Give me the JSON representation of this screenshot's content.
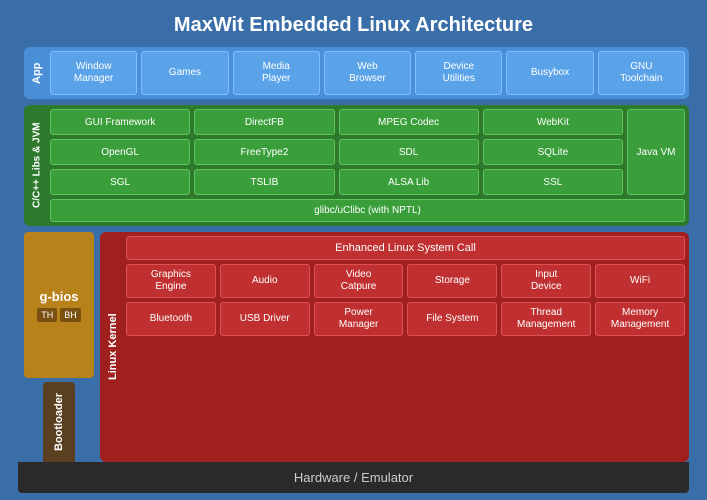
{
  "title": "MaxWit Embedded Linux Architecture",
  "layers": {
    "app": {
      "label": "App",
      "items": [
        {
          "label": "Window\nManager"
        },
        {
          "label": "Games"
        },
        {
          "label": "Media\nPlayer"
        },
        {
          "label": "Web\nBrowser"
        },
        {
          "label": "Device\nUtilities"
        },
        {
          "label": "Busybox"
        },
        {
          "label": "GNU\nToolchain"
        }
      ]
    },
    "libs": {
      "label": "C/C++ Libs & JVM",
      "rows": [
        [
          {
            "label": "GUI Framework"
          },
          {
            "label": "DirectFB"
          },
          {
            "label": "MPEG Codec"
          },
          {
            "label": "WebKit"
          }
        ],
        [
          {
            "label": "OpenGL"
          },
          {
            "label": "FreeType2"
          },
          {
            "label": "SDL"
          },
          {
            "label": "SQLite"
          }
        ],
        [
          {
            "label": "SGL"
          },
          {
            "label": "TSLIB"
          },
          {
            "label": "ALSA Lib"
          },
          {
            "label": "SSL"
          }
        ]
      ],
      "glibc": "glibc/uClibc (with NPTL)",
      "javavm": "Java VM"
    },
    "kernel": {
      "label": "Linux Kernel",
      "title": "Enhanced Linux System Call",
      "row1": [
        {
          "label": "Graphics\nEngine"
        },
        {
          "label": "Audio"
        },
        {
          "label": "Video\nCatpure"
        },
        {
          "label": "Storage"
        },
        {
          "label": "Input\nDevice"
        },
        {
          "label": "WiFi"
        }
      ],
      "row2": [
        {
          "label": "Bluetooth"
        },
        {
          "label": "USB Driver"
        },
        {
          "label": "Power\nManager"
        },
        {
          "label": "File System"
        },
        {
          "label": "Thread\nManagement"
        },
        {
          "label": "Memory\nManagement"
        }
      ]
    }
  },
  "bootloader": {
    "label": "Bootloader",
    "gbios": "g-bios",
    "badge1": "TH",
    "badge2": "BH"
  },
  "hardware": "Hardware / Emulator"
}
